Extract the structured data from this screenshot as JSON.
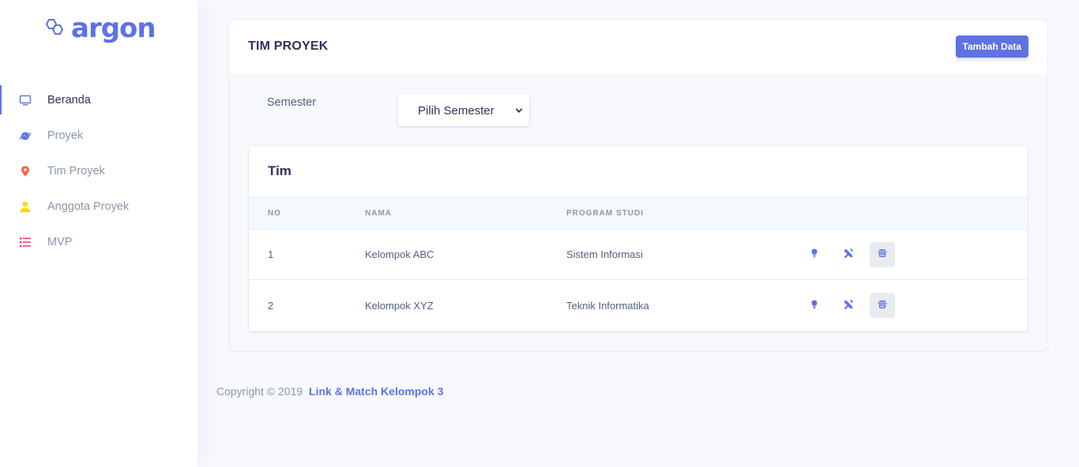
{
  "brand": {
    "name": "argon",
    "icon": "hexagon-logo-icon"
  },
  "sidebar": {
    "items": [
      {
        "label": "Beranda",
        "icon": "monitor-icon",
        "color": "#5e72e4",
        "active": true
      },
      {
        "label": "Proyek",
        "icon": "planet-icon",
        "color": "#5e72e4",
        "active": false
      },
      {
        "label": "Tim Proyek",
        "icon": "pin-icon",
        "color": "#fb6340",
        "active": false
      },
      {
        "label": "Anggota Proyek",
        "icon": "user-icon",
        "color": "#ffd600",
        "active": false
      },
      {
        "label": "MVP",
        "icon": "list-icon",
        "color": "#f5365c",
        "active": false
      }
    ]
  },
  "card": {
    "title": "TIM PROYEK",
    "add_button_label": "Tambah Data",
    "filter": {
      "label": "Semester",
      "selected": "Pilih Semester"
    }
  },
  "table": {
    "title": "Tim",
    "headers": [
      "NO",
      "NAMA",
      "PROGRAM STUDI"
    ],
    "rows": [
      {
        "no": "1",
        "nama": "Kelompok ABC",
        "prodi": "Sistem Informasi"
      },
      {
        "no": "2",
        "nama": "Kelompok XYZ",
        "prodi": "Teknik Informatika"
      }
    ],
    "actions": [
      "bulb-icon",
      "tools-icon",
      "basket-icon"
    ]
  },
  "footer": {
    "copyright": "Copyright © 2019",
    "link_text": "Link & Match Kelompok 3"
  },
  "colors": {
    "accent": "#5e72e4",
    "heading": "#32325d",
    "text": "#525f7f"
  }
}
